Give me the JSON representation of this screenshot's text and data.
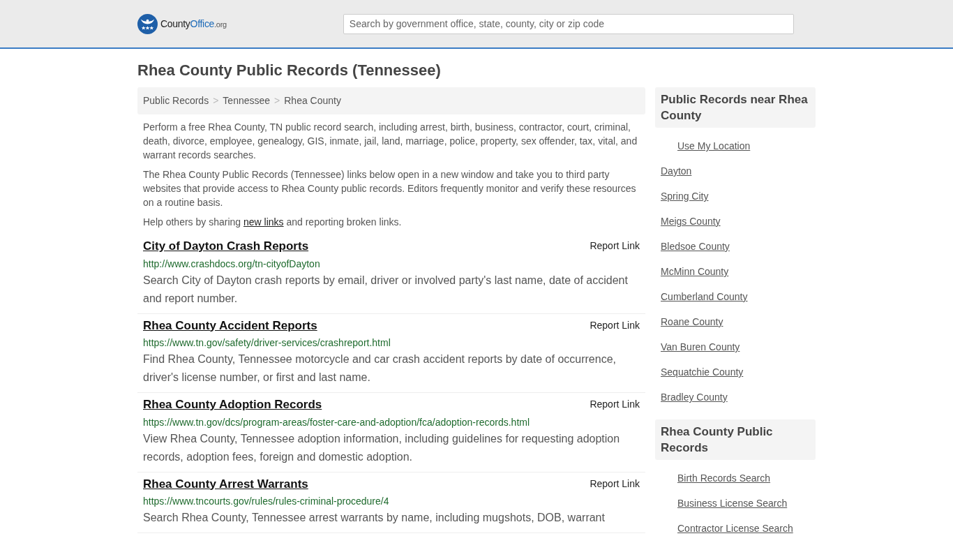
{
  "header": {
    "logo": {
      "name_start": "County",
      "name_accent": "Office",
      "suffix": ".org"
    },
    "search": {
      "placeholder": "Search by government office, state, county, city or zip code"
    }
  },
  "page_title": "Rhea County Public Records (Tennessee)",
  "breadcrumbs": [
    {
      "label": "Public Records"
    },
    {
      "separator": ">",
      "label": "Tennessee"
    },
    {
      "separator": ">",
      "label": "Rhea County"
    }
  ],
  "intro": [
    "Perform a free Rhea County, TN public record search, including arrest, birth, business, contractor, court, criminal, death, divorce, employee, genealogy, GIS, inmate, jail, land, marriage, police, property, sex offender, tax, vital, and warrant records searches.",
    "The Rhea County Public Records (Tennessee) links below open in a new window and take you to third party websites that provide access to Rhea County public records. Editors frequently monitor and verify these resources on a routine basis."
  ],
  "share_note": {
    "before": "Help others by sharing ",
    "link": "new links",
    "after": " and reporting broken links."
  },
  "records": [
    {
      "title": "City of Dayton Crash Reports",
      "report": "Report Link",
      "url": "http://www.crashdocs.org/tn-cityofDayton",
      "description": "Search City of Dayton crash reports by email, driver or involved party's last name, date of accident and report number."
    },
    {
      "title": "Rhea County Accident Reports",
      "report": "Report Link",
      "url": "https://www.tn.gov/safety/driver-services/crashreport.html",
      "description": "Find Rhea County, Tennessee motorcycle and car crash accident reports by date of occurrence, driver's license number, or first and last name."
    },
    {
      "title": "Rhea County Adoption Records",
      "report": "Report Link",
      "url": "https://www.tn.gov/dcs/program-areas/foster-care-and-adoption/fca/adoption-records.html",
      "description": "View Rhea County, Tennessee adoption information, including guidelines for requesting adoption records, adoption fees, foreign and domestic adoption."
    },
    {
      "title": "Rhea County Arrest Warrants",
      "report": "Report Link",
      "url": "https://www.tncourts.gov/rules/rules-criminal-procedure/4",
      "description": "Search Rhea County, Tennessee arrest warrants by name, including mugshots, DOB, warrant"
    }
  ],
  "sidebar": [
    {
      "heading": "Public Records near Rhea County",
      "items": [
        {
          "label": "Use My Location",
          "kind": "indented"
        },
        {
          "label": "Dayton",
          "kind": "plain"
        },
        {
          "label": "Spring City",
          "kind": "plain"
        },
        {
          "label": "Meigs County",
          "kind": "plain"
        },
        {
          "label": "Bledsoe County",
          "kind": "plain"
        },
        {
          "label": "McMinn County",
          "kind": "plain"
        },
        {
          "label": "Cumberland County",
          "kind": "plain"
        },
        {
          "label": "Roane County",
          "kind": "plain"
        },
        {
          "label": "Van Buren County",
          "kind": "plain"
        },
        {
          "label": "Sequatchie County",
          "kind": "plain"
        },
        {
          "label": "Bradley County",
          "kind": "plain"
        }
      ]
    },
    {
      "heading": "Rhea County Public Records",
      "items": [
        {
          "label": "Birth Records Search",
          "kind": "indented"
        },
        {
          "label": "Business License Search",
          "kind": "indented"
        },
        {
          "label": "Contractor License Search",
          "kind": "indented"
        }
      ]
    }
  ]
}
